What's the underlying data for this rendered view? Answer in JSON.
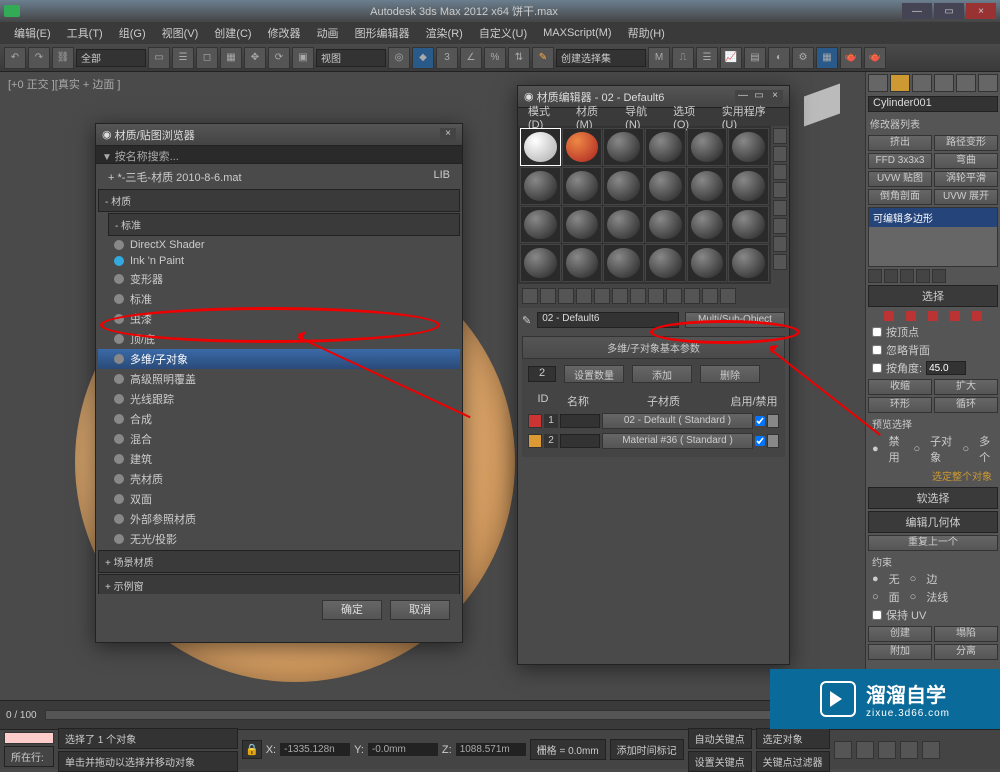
{
  "titlebar": {
    "title": "Autodesk 3ds Max  2012 x64      饼干.max"
  },
  "menubar": [
    "编辑(E)",
    "工具(T)",
    "组(G)",
    "视图(V)",
    "创建(C)",
    "修改器",
    "动画",
    "图形编辑器",
    "渲染(R)",
    "自定义(U)",
    "MAXScript(M)",
    "帮助(H)"
  ],
  "toolbar_select_label": "全部",
  "toolbar_view_label": "视图",
  "toolbar_selset_label": "创建选择集",
  "viewport_label": "[+0 正交 ][真实 + 边面 ]",
  "mat_browser": {
    "title": "材质/贴图浏览器",
    "search_placeholder": "按名称搜索...",
    "lib_name": "+ *-三毛-材质 2010-8-6.mat",
    "lib_tag": "LIB",
    "grp_materials": "- 材质",
    "grp_std": "- 标准",
    "items": [
      {
        "label": "DirectX Shader",
        "dot": "d-gray"
      },
      {
        "label": "Ink 'n Paint",
        "dot": "d-cyan"
      },
      {
        "label": "变形器",
        "dot": "d-gray"
      },
      {
        "label": "标准",
        "dot": "d-blue"
      },
      {
        "label": "虫漆",
        "dot": "d-red"
      },
      {
        "label": "顶/底",
        "dot": "d-gray"
      },
      {
        "label": "多维/子对象",
        "dot": "d-gray",
        "selected": true
      },
      {
        "label": "高级照明覆盖",
        "dot": "d-gray"
      },
      {
        "label": "光线跟踪",
        "dot": "d-gray"
      },
      {
        "label": "合成",
        "dot": "d-gray"
      },
      {
        "label": "混合",
        "dot": "d-gray"
      },
      {
        "label": "建筑",
        "dot": "d-gray"
      },
      {
        "label": "壳材质",
        "dot": "d-gray"
      },
      {
        "label": "双面",
        "dot": "d-gray"
      },
      {
        "label": "外部参照材质",
        "dot": "d-green"
      },
      {
        "label": "无光/投影",
        "dot": "d-gray"
      }
    ],
    "grp_scene": "+ 场景材质",
    "grp_sample": "+ 示例窗",
    "ok": "确定",
    "cancel": "取消"
  },
  "mat_editor": {
    "title": "材质编辑器 - 02 - Default6",
    "menus": [
      "模式(D)",
      "材质(M)",
      "导航(N)",
      "选项(O)",
      "实用程序(U)"
    ],
    "mat_name": "02 - Default6",
    "type_btn": "Multi/Sub-Object",
    "rollout_title": "多维/子对象基本参数",
    "count": "2",
    "set_count": "设置数量",
    "add": "添加",
    "delete": "删除",
    "hdr_id": "ID",
    "hdr_name": "名称",
    "hdr_sub": "子材质",
    "hdr_en": "启用/禁用",
    "rows": [
      {
        "id": "1",
        "name": "",
        "sub": "02 - Default ( Standard )",
        "sw": "#c33"
      },
      {
        "id": "2",
        "name": "",
        "sub": "Material #36 ( Standard )",
        "sw": "#d93"
      }
    ]
  },
  "right": {
    "obj_name": "Cylinder001",
    "mod_list_label": "修改器列表",
    "btns": [
      "挤出",
      "路径变形",
      "FFD 3x3x3",
      "弯曲",
      "UVW 贴图",
      "涡轮平滑",
      "倒角剖面",
      "UVW 展开"
    ],
    "stack_item": "可编辑多边形",
    "rollout_select": "选择",
    "chk_vertex": "按顶点",
    "chk_ignore": "忽略背面",
    "chk_angle": "按角度:",
    "angle_val": "45.0",
    "btn_shrink": "收缩",
    "btn_grow": "扩大",
    "btn_ring": "环形",
    "btn_loop": "循环",
    "preview_lbl": "预览选择",
    "radio_off": "禁用",
    "radio_sub": "子对象",
    "radio_multi": "多个",
    "status": "选定整个对象",
    "rollout_soft": "软选择",
    "rollout_editgeo": "编辑几何体",
    "repeat": "重复上一个",
    "constraint_lbl": "约束",
    "r_none": "无",
    "r_edge": "边",
    "r_face": "面",
    "r_normal": "法线",
    "chk_keepuv": "保持 UV",
    "btn_create": "创建",
    "btn_collapse": "塌陷",
    "btn_attach": "附加",
    "btn_detach": "分离"
  },
  "timeline": {
    "frames": "0 / 100"
  },
  "status": {
    "sel": "选择了 1 个对象",
    "hint": "单击并拖动以选择并移动对象",
    "x_lbl": "X:",
    "x": "-1335.128n",
    "y_lbl": "Y:",
    "y": "-0.0mm",
    "z_lbl": "Z:",
    "z": "1088.571m",
    "grid": "栅格 = 0.0mm",
    "auto_key": "自动关键点",
    "sel_filter": "选定对象",
    "set_key": "设置关键点",
    "key_filter": "关键点过滤器",
    "nowhere": "所在行:",
    "addtime": "添加时间标记"
  },
  "watermark": {
    "big": "溜溜自学",
    "url": "zixue.3d66.com"
  }
}
